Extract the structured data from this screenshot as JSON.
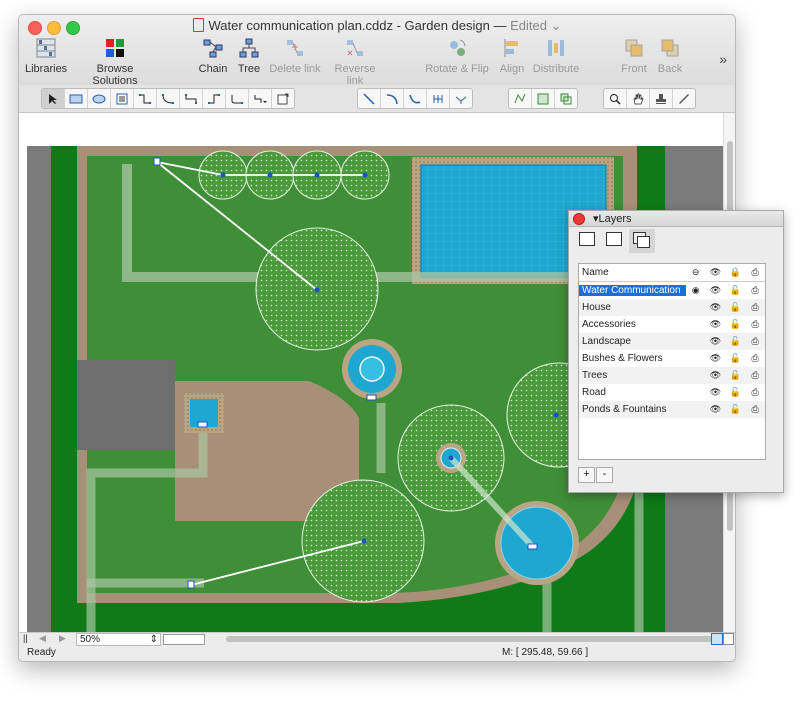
{
  "window": {
    "title": "Water communication plan.cddz - Garden design",
    "dash": "—",
    "edited": "Edited"
  },
  "toolbar": {
    "libraries": "Libraries",
    "browse_solutions": "Browse Solutions",
    "chain": "Chain",
    "tree": "Tree",
    "delete_link": "Delete link",
    "reverse_link": "Reverse link",
    "rotate_flip": "Rotate & Flip",
    "align": "Align",
    "distribute": "Distribute",
    "front": "Front",
    "back": "Back",
    "more": "»"
  },
  "icons": {
    "libraries": "libraries-icon",
    "browse": "browse-solutions-icon",
    "chain": "chain-icon",
    "tree": "tree-icon"
  },
  "colors": {
    "grass": "#3f8f38",
    "path": "#a89078",
    "pool": "#1ea7d0",
    "border_green": "#0f7a18",
    "road": "#6e6e6e",
    "selection": "#1c6fd9"
  },
  "status": {
    "ready": "Ready",
    "mouse": "M: [ 295.48, 59.66 ]"
  },
  "zoom": {
    "value": "50%"
  },
  "layers": {
    "title": "Layers",
    "header_name": "Name",
    "rows": [
      {
        "name": "Water Communication",
        "selected": true
      },
      {
        "name": "House",
        "selected": false
      },
      {
        "name": "Accessories",
        "selected": false
      },
      {
        "name": "Landscape",
        "selected": false
      },
      {
        "name": "Bushes & Flowers",
        "selected": false
      },
      {
        "name": "Trees",
        "selected": false
      },
      {
        "name": "Road",
        "selected": false
      },
      {
        "name": "Ponds & Fountains",
        "selected": false
      }
    ],
    "add": "+",
    "remove": "-"
  }
}
